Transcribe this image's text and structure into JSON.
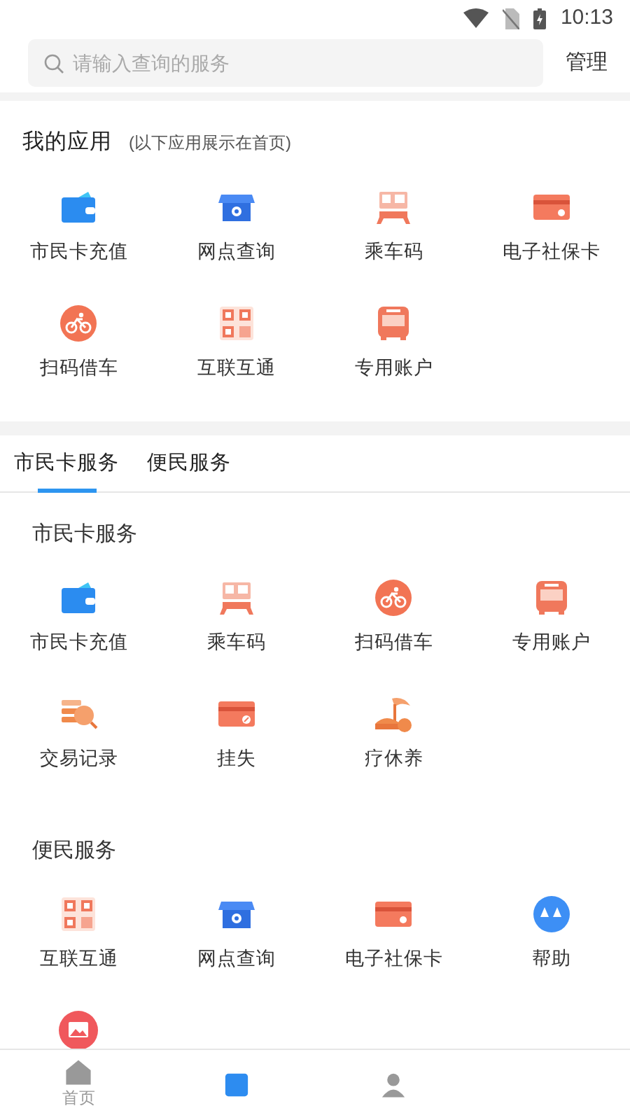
{
  "status_bar": {
    "time": "10:13"
  },
  "search": {
    "placeholder": "请输入查询的服务"
  },
  "manage_button": "管理",
  "my_apps": {
    "title": "我的应用",
    "subtitle": "(以下应用展示在首页)",
    "items": [
      {
        "kind": "wallet",
        "label": "市民卡充值"
      },
      {
        "kind": "store",
        "label": "网点查询"
      },
      {
        "kind": "ride",
        "label": "乘车码"
      },
      {
        "kind": "card",
        "label": "电子社保卡"
      },
      {
        "kind": "bike",
        "label": "扫码借车"
      },
      {
        "kind": "qr",
        "label": "互联互通"
      },
      {
        "kind": "bus",
        "label": "专用账户"
      }
    ]
  },
  "tabs": [
    {
      "label": "市民卡服务",
      "selected": true
    },
    {
      "label": "便民服务",
      "selected": false
    }
  ],
  "sections": [
    {
      "title": "市民卡服务",
      "items": [
        {
          "kind": "wallet",
          "label": "市民卡充值"
        },
        {
          "kind": "ride",
          "label": "乘车码"
        },
        {
          "kind": "bike",
          "label": "扫码借车"
        },
        {
          "kind": "bus",
          "label": "专用账户"
        },
        {
          "kind": "records",
          "label": "交易记录"
        },
        {
          "kind": "lost",
          "label": "挂失"
        },
        {
          "kind": "vacation",
          "label": "疗休养"
        }
      ]
    },
    {
      "title": "便民服务",
      "items": [
        {
          "kind": "qr",
          "label": "互联互通"
        },
        {
          "kind": "store",
          "label": "网点查询"
        },
        {
          "kind": "card",
          "label": "电子社保卡"
        },
        {
          "kind": "help",
          "label": "帮助"
        },
        {
          "kind": "image"
        }
      ]
    }
  ],
  "bottom_nav": [
    {
      "kind": "home",
      "label": "首页",
      "selected": false
    },
    {
      "kind": "service",
      "selected": true
    },
    {
      "kind": "user",
      "selected": false
    }
  ]
}
